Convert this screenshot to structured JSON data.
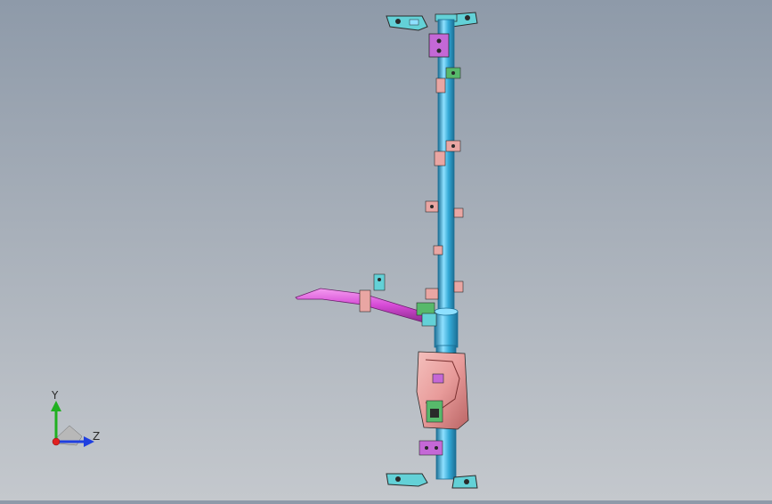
{
  "viewport": {
    "colors": {
      "pipe": "#33a9d6",
      "pipe_highlight": "#8ee0ff",
      "pipe_shadow": "#1b6f95",
      "bracket_cyan": "#63d1d7",
      "bracket_magenta": "#c468d6",
      "bracket_green": "#57b96b",
      "bracket_salmon": "#e9a6a3",
      "steering_column": "#d64ad6",
      "module_body": "#e89b9a",
      "module_shadow": "#b96464",
      "edge": "#2a2a2a"
    },
    "brackets": [
      {
        "name": "top-left-mount",
        "color": "cyan"
      },
      {
        "name": "top-right-mount",
        "color": "cyan"
      },
      {
        "name": "upper-bracket",
        "color": "magenta"
      },
      {
        "name": "bracket-1",
        "color": "green"
      },
      {
        "name": "bracket-2",
        "color": "salmon"
      },
      {
        "name": "bracket-3",
        "color": "salmon"
      },
      {
        "name": "bracket-4",
        "color": "salmon"
      },
      {
        "name": "bracket-5",
        "color": "salmon"
      },
      {
        "name": "bracket-6",
        "color": "salmon"
      },
      {
        "name": "bracket-7",
        "color": "salmon"
      },
      {
        "name": "bottom-bracket",
        "color": "magenta"
      },
      {
        "name": "bottom-left-mount",
        "color": "cyan"
      },
      {
        "name": "bottom-right-mount",
        "color": "cyan"
      }
    ]
  },
  "triad": {
    "y_label": "Y",
    "z_label": "Z",
    "colors": {
      "y_axis": "#20b020",
      "z_axis": "#1f3fe0",
      "x_axis": "#e02020"
    }
  }
}
